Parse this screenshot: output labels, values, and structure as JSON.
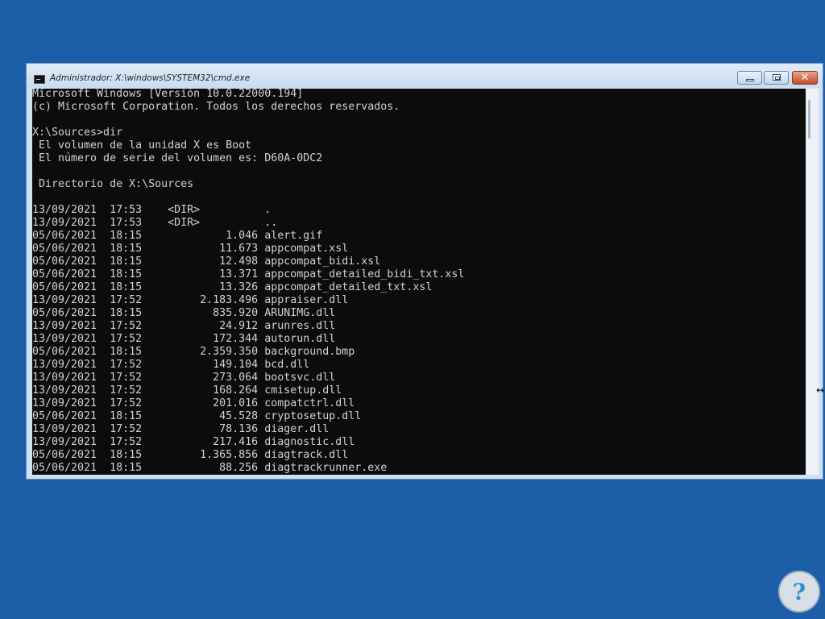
{
  "window": {
    "title": "Administrador: X:\\windows\\SYSTEM32\\cmd.exe",
    "icon": "cmd-console-icon",
    "controls": {
      "minimize": "minimize-icon",
      "maximize": "maximize-icon",
      "close": "close-icon",
      "close_glyph": "✕"
    }
  },
  "console": {
    "lines": [
      "Microsoft Windows [Versión 10.0.22000.194]",
      "(c) Microsoft Corporation. Todos los derechos reservados.",
      "",
      "X:\\Sources>dir",
      " El volumen de la unidad X es Boot",
      " El número de serie del volumen es: D60A-0DC2",
      "",
      " Directorio de X:\\Sources",
      "",
      "13/09/2021  17:53    <DIR>          .",
      "13/09/2021  17:53    <DIR>          ..",
      "05/06/2021  18:15             1.046 alert.gif",
      "05/06/2021  18:15            11.673 appcompat.xsl",
      "05/06/2021  18:15            12.498 appcompat_bidi.xsl",
      "05/06/2021  18:15            13.371 appcompat_detailed_bidi_txt.xsl",
      "05/06/2021  18:15            13.326 appcompat_detailed_txt.xsl",
      "13/09/2021  17:52         2.183.496 appraiser.dll",
      "05/06/2021  18:15           835.920 ARUNIMG.dll",
      "13/09/2021  17:52            24.912 arunres.dll",
      "13/09/2021  17:52           172.344 autorun.dll",
      "05/06/2021  18:15         2.359.350 background.bmp",
      "13/09/2021  17:52           149.104 bcd.dll",
      "13/09/2021  17:52           273.064 bootsvc.dll",
      "13/09/2021  17:52           168.264 cmisetup.dll",
      "13/09/2021  17:52           201.016 compatctrl.dll",
      "05/06/2021  18:15            45.528 cryptosetup.dll",
      "13/09/2021  17:52            78.136 diager.dll",
      "13/09/2021  17:52           217.416 diagnostic.dll",
      "05/06/2021  18:15         1.365.856 diagtrack.dll",
      "05/06/2021  18:15            88.256 diagtrackrunner.exe"
    ]
  },
  "colors": {
    "desktop": "#1c5fa8",
    "console_bg": "#0c0c0c",
    "console_fg": "#d2d2d2"
  },
  "watermark": {
    "icon": "help-logo-icon",
    "glyph": "?"
  }
}
